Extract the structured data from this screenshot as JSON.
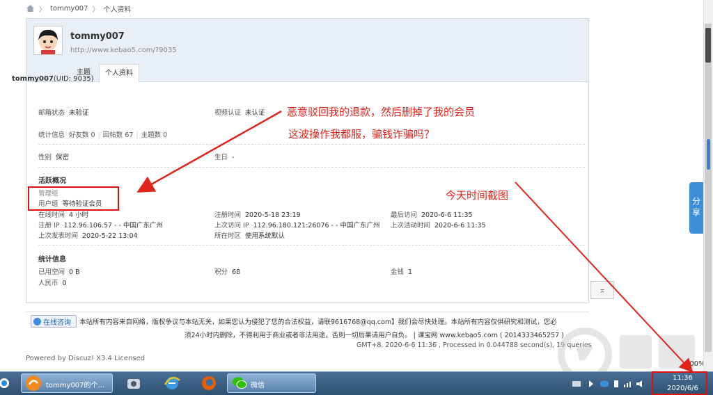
{
  "breadcrumb": {
    "items": [
      "tommy007",
      "个人资料"
    ]
  },
  "profile": {
    "name": "tommy007",
    "url": "http://www.kebao5.com/?9035",
    "tabs": [
      "主题",
      "个人资料"
    ],
    "uid_name": "tommy007",
    "uid_text": "(UID: 9035)",
    "email_label": "邮箱状态",
    "email_value": "未验证",
    "video_label": "视频认证",
    "video_value": "未认证",
    "stats_label": "统计信息",
    "friends": "好友数 0",
    "replies": "回帖数 67",
    "threads": "主题数 0",
    "gender_label": "性别",
    "gender_value": "保密",
    "birthday_label": "生日",
    "birthday_value": "-"
  },
  "activity": {
    "title": "活跃概况",
    "admin_group_label": "管理组",
    "user_group_label": "用户组",
    "user_group_value": "等待验证会员",
    "online_label": "在线时间",
    "online_value": "4 小时",
    "register_label": "注册时间",
    "register_value": "2020-5-18 23:19",
    "last_visit_label": "最后访问",
    "last_visit_value": "2020-6-6 11:35",
    "register_ip_label": "注册 IP",
    "register_ip_value": "112.96.106.57 - - 中国广东广州",
    "last_ip_label": "上次访问 IP",
    "last_ip_value": "112.96.180.121:26076 - - 中国广东广州",
    "last_active_label": "上次活动时间",
    "last_active_value": "2020-6-6 11:35",
    "last_post_label": "上次发表时间",
    "last_post_value": "2020-5-22 13:04",
    "timezone_label": "所在时区",
    "timezone_value": "使用系统默认"
  },
  "stats": {
    "title": "统计信息",
    "space_label": "已用空间",
    "space_value": "0 B",
    "points_label": "积分",
    "points_value": "68",
    "money_label": "金钱",
    "money_value": "1",
    "rmb_label": "人民币",
    "rmb_value": "0"
  },
  "annotations": {
    "line1": "恶意驳回我的退款，然后删掉了我的会员",
    "line2": "这波操作我都服，骗钱诈骗吗？",
    "line3": "今天时间截图"
  },
  "footer": {
    "chat_label": "在线咨询",
    "line1": "本站所有内容来自网络，版权争议与本站无关，如果您认为侵犯了您的合法权益，请联9616768@qq.com】我们会尽快处理。本站所有内容仅供研究和测试，您必",
    "line2": "须24小时内删除，不得利用于商业或者非法用途，否则一切后果请用户自负。 | 课宝网 www.kebao5.com ( 2014333465257 )",
    "line3": "GMT+8, 2020-6-6 11:36 , Processed in 0.044788 second(s), 19 queries",
    "powered": "Powered by Discuz! X3.4 Licensed"
  },
  "widgets": {
    "share": "分享",
    "zoom": "100%"
  },
  "taskbar": {
    "browser_tab": "tommy007的个...",
    "wechat": "微信",
    "time": "11:36",
    "date": "2020/6/6"
  },
  "colors": {
    "accent": "#3b8fd9",
    "annotation": "#e2231a",
    "taskbar": "#2e5070"
  }
}
